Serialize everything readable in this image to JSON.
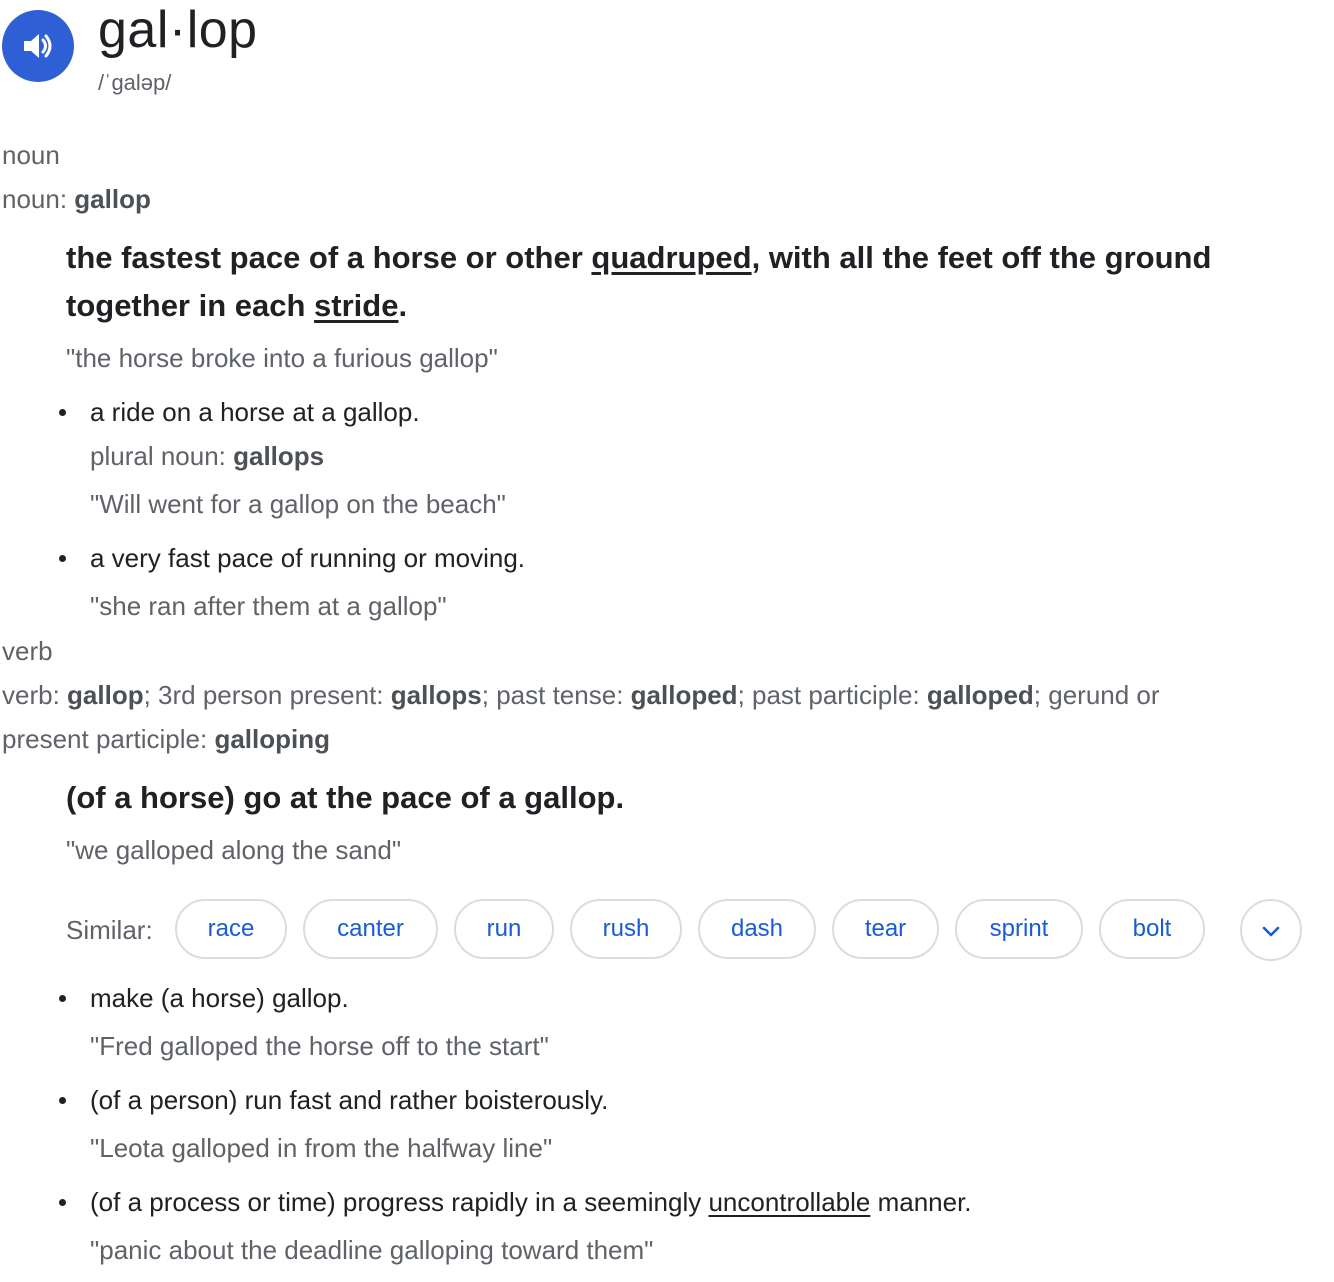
{
  "header": {
    "word": "gal·lop",
    "phonetic": "/ˈɡaləp/",
    "speaker_icon": "volume-icon",
    "accent": "#2f5fd4"
  },
  "noun": {
    "pos": "noun",
    "forms_label": "noun",
    "forms_word": "gallop",
    "definition_part1": "the fastest pace of a horse or other ",
    "definition_link1": "quadruped",
    "definition_part2": ", with all the feet off the ground",
    "definition_part3": "together in each ",
    "definition_link2": "stride",
    "definition_part4": ".",
    "example": "\"the horse broke into a furious gallop\"",
    "sense1_text": "a ride on a horse at a gallop.",
    "sense1_forms_label": "plural noun",
    "sense1_forms_word": "gallops",
    "sense1_example": "\"Will went for a gallop on the beach\"",
    "sense2_text": "a very fast pace of running or moving.",
    "sense2_example": "\"she ran after them at a gallop\""
  },
  "verb": {
    "pos": "verb",
    "forms": {
      "l1": "verb",
      "w1": "gallop",
      "l2": "3rd person present",
      "w2": "gallops",
      "l3": "past tense",
      "w3": "galloped",
      "l4": "past participle",
      "w4": "galloped",
      "l5a": "gerund or",
      "l5b": "present participle",
      "w5": "galloping"
    },
    "definition": "(of a horse) go at the pace of a gallop.",
    "example": "\"we galloped along the sand\"",
    "similar_label": "Similar:",
    "similar": [
      "race",
      "canter",
      "run",
      "rush",
      "dash",
      "tear",
      "sprint",
      "bolt"
    ],
    "expand_icon": "chevron-down-icon",
    "sense1_text": "make (a horse) gallop.",
    "sense1_example": "\"Fred galloped the horse off to the start\"",
    "sense2_text": "(of a person) run fast and rather boisterously.",
    "sense2_example": "\"Leota galloped in from the halfway line\"",
    "sense3_text_a": "(of a process or time) progress rapidly in a seemingly ",
    "sense3_link": "uncontrollable",
    "sense3_text_b": " manner.",
    "sense3_example": "\"panic about the deadline galloping toward them\""
  },
  "link_color": "#1a5bd6"
}
